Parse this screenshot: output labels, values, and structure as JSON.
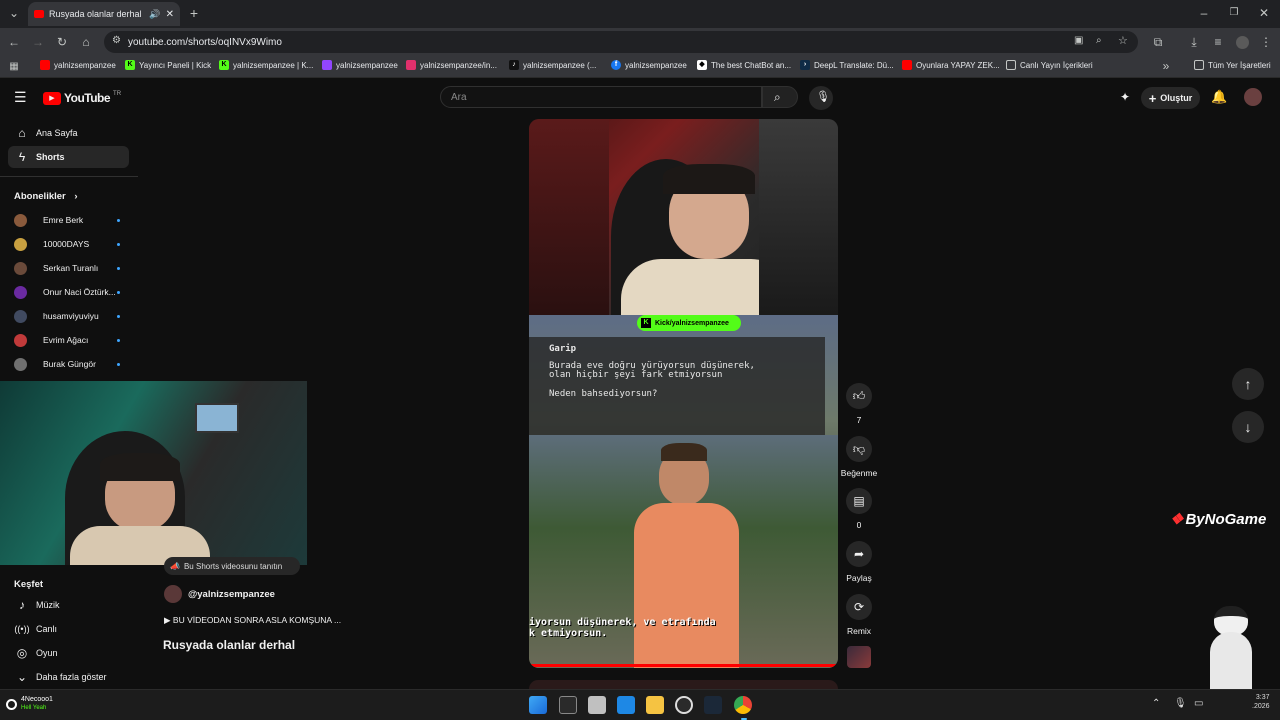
{
  "browser": {
    "tab_title": "Rusyada olanlar derhal - Yo",
    "url": "youtube.com/shorts/oqINVx9Wimo",
    "bookmarks": [
      {
        "label": "yalnizsempanzee",
        "icon": "youtube-icon",
        "color": "#ff0000"
      },
      {
        "label": "Yayıncı Paneli | Kick",
        "icon": "kick-icon",
        "color": "#53fc18"
      },
      {
        "label": "yalnizsempanzee | K...",
        "icon": "kick-icon",
        "color": "#53fc18"
      },
      {
        "label": "yalnizsempanzee",
        "icon": "twitch-icon",
        "color": "#9146ff"
      },
      {
        "label": "yalnizsempanzee/in...",
        "icon": "instagram-icon",
        "color": "#e1306c"
      },
      {
        "label": "yalnizsempanzee (...",
        "icon": "tiktok-icon",
        "color": "#111111"
      },
      {
        "label": "yalnizsempanzee",
        "icon": "facebook-icon",
        "color": "#1877f2"
      },
      {
        "label": "The best ChatBot an...",
        "icon": "chatbot-icon",
        "color": "#ffffff"
      },
      {
        "label": "DeepL Translate: Dü...",
        "icon": "deepl-icon",
        "color": "#0f2b46"
      },
      {
        "label": "Oyunlara YAPAY ZEK...",
        "icon": "youtube-icon",
        "color": "#ff0000"
      },
      {
        "label": "Canlı Yayın İçerikleri",
        "icon": "folder-icon",
        "color": "#c4c7c5"
      }
    ],
    "all_bookmarks": "Tüm Yer İşaretleri"
  },
  "youtube": {
    "logo_text": "YouTube",
    "region": "TR",
    "search_placeholder": "Ara",
    "create_label": "Oluştur",
    "nav": [
      {
        "label": "Ana Sayfa",
        "icon": "home-icon"
      },
      {
        "label": "Shorts",
        "icon": "shorts-icon"
      }
    ],
    "subscriptions_title": "Abonelikler",
    "subscriptions": [
      {
        "label": "Emre Berk",
        "color": "#8a5a3c"
      },
      {
        "label": "10000DAYS",
        "color": "#c8a040"
      },
      {
        "label": "Serkan Turanlı",
        "color": "#6a4a3a"
      },
      {
        "label": "Onur Naci Öztürk...",
        "color": "#6a2aa0"
      },
      {
        "label": "husamviyuviyu",
        "color": "#404a60"
      },
      {
        "label": "Evrim Ağacı",
        "color": "#c03a3a"
      },
      {
        "label": "Burak Güngör",
        "color": "#707070"
      }
    ],
    "explore_title": "Keşfet",
    "explore": [
      {
        "label": "Müzik",
        "icon": "music-icon"
      },
      {
        "label": "Canlı",
        "icon": "live-icon"
      },
      {
        "label": "Oyun",
        "icon": "game-icon"
      },
      {
        "label": "Daha fazla göster",
        "icon": "chevron-down-icon"
      }
    ]
  },
  "short": {
    "promote_label": "Bu Shorts videosunu tanıtın",
    "channel": "@yalnizsempanzee",
    "description": "▶ BU VİDEODAN SONRA ASLA KOMŞUNA ...",
    "title": "Rusyada olanlar derhal",
    "overlay_kick": "Kick/yalnizsempanzee",
    "game_speaker": "Garip",
    "game_line1": "Burada eve doğru yürüyorsun düşünerek,",
    "game_line2": "olan hiçbir şeyi fark etmiyorsun",
    "game_question": "Neden bahsediyorsun?",
    "subtitle_line1": "iyorsun düşünerek, ve etrafında",
    "subtitle_line2": "k etmiyorsun.",
    "likes": "7",
    "dislike_label": "Beğenme",
    "comments": "0",
    "share_label": "Paylaş",
    "remix_label": "Remix"
  },
  "overlay": {
    "watermark": "ByNoGame",
    "stream_user": "4Necooo1",
    "stream_msg": "Hell Yeah"
  },
  "taskbar": {
    "clock_time": "3:37",
    "clock_date": ".2026"
  }
}
